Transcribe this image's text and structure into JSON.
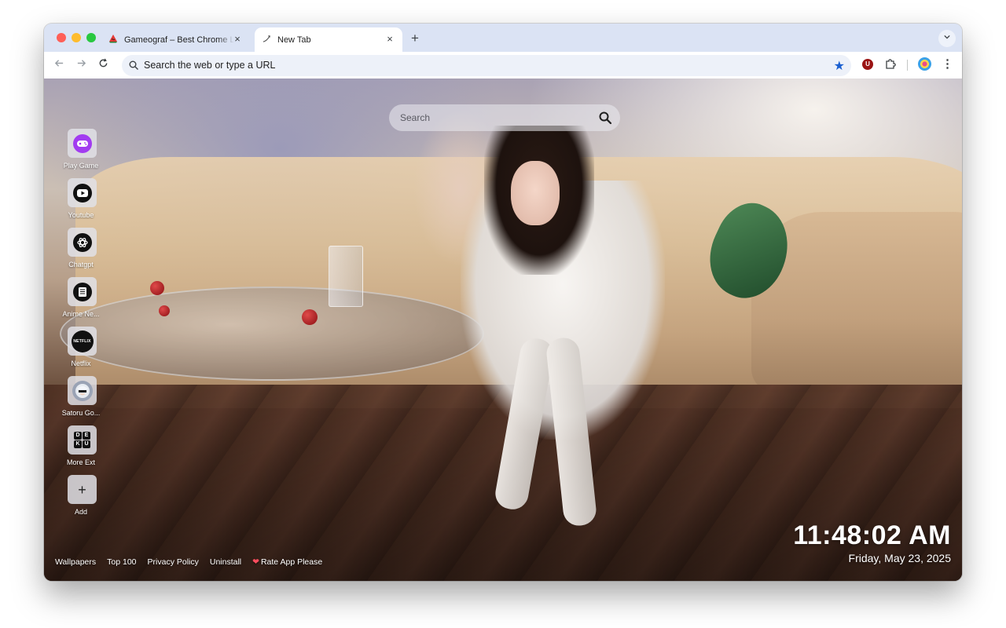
{
  "browser": {
    "tabs": [
      {
        "title": "Gameograf – Best Chrome Li",
        "active": false,
        "favicon": "watermelon-icon"
      },
      {
        "title": "New Tab",
        "active": true,
        "favicon": "sparkle-icon"
      }
    ],
    "new_tab_label": "+",
    "close_glyph": "×",
    "omnibox": {
      "text": "Search the web or type a URL"
    },
    "extensions": {
      "ublock_letter": "U"
    }
  },
  "ntp": {
    "search": {
      "placeholder": "Search"
    },
    "shortcuts": [
      {
        "label": "Play Game",
        "icon": "gamepad-icon",
        "color": "#a23cf0"
      },
      {
        "label": "Youtube",
        "icon": "youtube-icon",
        "color": "#111111"
      },
      {
        "label": "Chatgpt",
        "icon": "openai-icon",
        "color": "#111111"
      },
      {
        "label": "Anime Ne...",
        "icon": "newspaper-icon",
        "color": "#111111"
      },
      {
        "label": "Netflix",
        "icon": "netflix-icon",
        "color": "#111111",
        "badge_text": "NETFLIX"
      },
      {
        "label": "Satoru Go...",
        "icon": "anime-avatar-icon",
        "color": "#9aa3b5"
      },
      {
        "label": "More Ext",
        "icon": "deku-grid-icon",
        "color": "#111111",
        "grid_letters": [
          "D",
          "E",
          "K",
          "U"
        ]
      },
      {
        "label": "Add",
        "icon": "plus-icon",
        "glyph": "+"
      }
    ],
    "clock": {
      "time": "11:48:02 AM",
      "date": "Friday, May 23, 2025"
    },
    "footer_links": [
      "Wallpapers",
      "Top 100",
      "Privacy Policy",
      "Uninstall",
      "Rate App Please"
    ]
  }
}
